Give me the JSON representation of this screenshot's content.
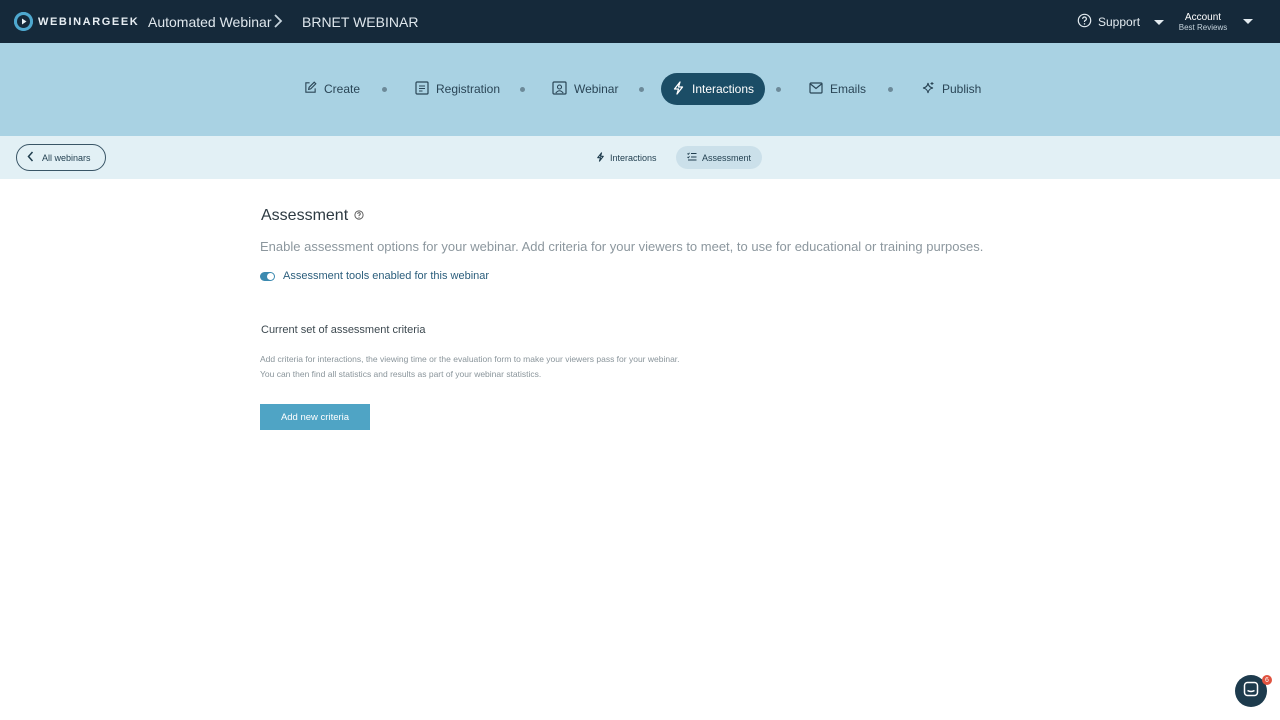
{
  "app": {
    "logo_text": "WEBINARGEEK"
  },
  "breadcrumb": {
    "first": "Automated Webinar",
    "second": "BRNET WEBINAR"
  },
  "header": {
    "support_label": "Support",
    "account_label": "Account",
    "account_sub": "Best Reviews"
  },
  "steps": [
    {
      "label": "Create",
      "icon": "edit-icon"
    },
    {
      "label": "Registration",
      "icon": "form-icon"
    },
    {
      "label": "Webinar",
      "icon": "monitor-icon"
    },
    {
      "label": "Interactions",
      "icon": "lightning-icon",
      "active": true
    },
    {
      "label": "Emails",
      "icon": "envelope-icon"
    },
    {
      "label": "Publish",
      "icon": "sparkle-icon"
    }
  ],
  "subnav": {
    "back_label": "All webinars",
    "tabs": [
      {
        "label": "Interactions",
        "icon": "lightning-icon"
      },
      {
        "label": "Assessment",
        "icon": "checklist-icon",
        "active": true
      }
    ]
  },
  "main": {
    "title": "Assessment",
    "intro": "Enable assessment options for your webinar. Add criteria for your viewers to meet, to use for educational or training purposes.",
    "toggle_label": "Assessment tools enabled for this webinar",
    "toggle_on": true,
    "criteria_title": "Current set of assessment criteria",
    "criteria_desc_line1": "Add criteria for interactions, the viewing time or the evaluation form to make your viewers pass for your webinar.",
    "criteria_desc_line2": "You can then find all statistics and results as part of your webinar statistics.",
    "add_button": "Add new criteria"
  },
  "chat": {
    "badge_count": "6"
  },
  "colors": {
    "topbar": "#15293a",
    "steps_bg": "#a9d2e3",
    "active_step": "#1b4d66",
    "subbar": "#e2f0f5",
    "button": "#4fa4c5"
  }
}
